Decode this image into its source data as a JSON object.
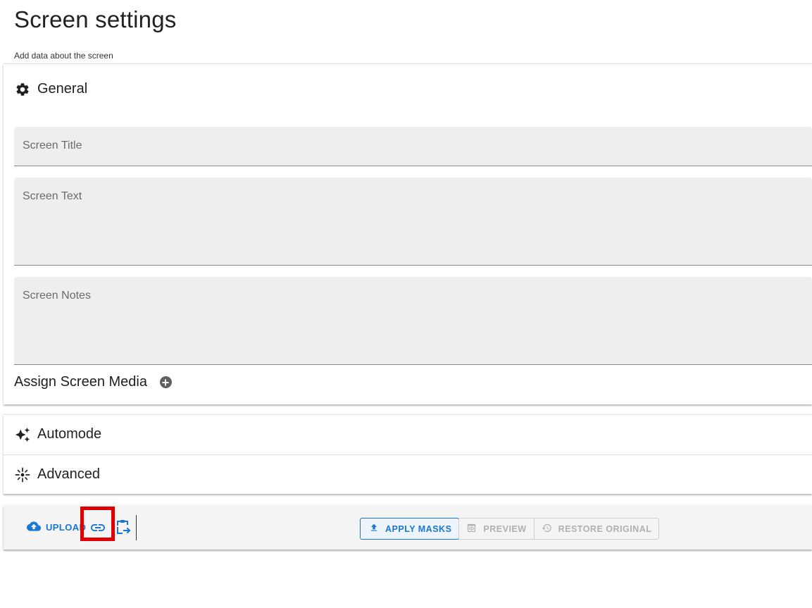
{
  "page": {
    "title": "Screen settings",
    "subtitle": "Add data about the screen"
  },
  "general": {
    "title": "General",
    "icon": "gear-icon",
    "fields": {
      "screen_title": {
        "placeholder": "Screen Title",
        "value": ""
      },
      "screen_text": {
        "placeholder": "Screen Text",
        "value": ""
      },
      "screen_notes": {
        "placeholder": "Screen Notes",
        "value": ""
      }
    },
    "assign_media_label": "Assign Screen Media"
  },
  "automode": {
    "title": "Automode",
    "icon": "sparkles-icon"
  },
  "advanced": {
    "title": "Advanced",
    "icon": "settings-spark-icon"
  },
  "toolbar": {
    "upload_label": "UPLOAD",
    "apply_masks_label": "APPLY MASKS",
    "preview_label": "PREVIEW",
    "restore_original_label": "RESTORE ORIGINAL"
  },
  "colors": {
    "accent": "#1976d2",
    "highlight": "#e00000",
    "field_bg": "#eeeeee",
    "disabled": "#b0b0b0"
  }
}
